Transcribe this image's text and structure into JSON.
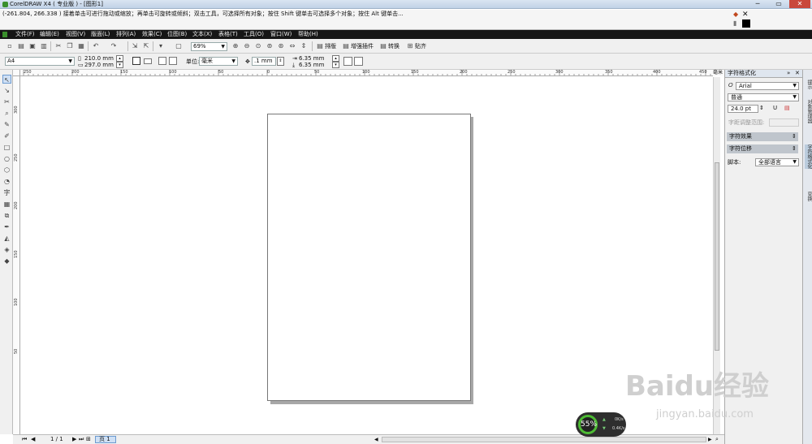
{
  "window": {
    "title": "CorelDRAW X4 ( 专业版 ) - [图形1]",
    "minimize_glyph": "─",
    "maximize_glyph": "▭",
    "close_glyph": "✕"
  },
  "hint_bar": {
    "text": "(-261.804, 266.338 )   接着单击可进行拖动或缩放；再单击可旋转或倾斜；双击工具，可选择所有对象；按住 Shift 键单击可选择多个对象；按住 Alt 键单击..."
  },
  "menu": {
    "items": [
      "文件(F)",
      "编辑(E)",
      "视图(V)",
      "版面(L)",
      "排列(A)",
      "效果(C)",
      "位图(B)",
      "文本(X)",
      "表格(T)",
      "工具(O)",
      "窗口(W)",
      "帮助(H)"
    ]
  },
  "toolbar": {
    "zoom_value": "69%",
    "arrange_label": "排版",
    "enhance_label": "增强插件",
    "convert_label": "转换",
    "snap_label": "贴齐"
  },
  "property_bar": {
    "paper_size": "A4",
    "width": "210.0 mm",
    "height": "297.0 mm",
    "units_label": "单位:",
    "units_value": "毫米",
    "nudge": ".1 mm",
    "dup_x": "6.35 mm",
    "dup_y": "6.35 mm"
  },
  "rulers": {
    "top_labels": [
      "250",
      "200",
      "150",
      "100",
      "50",
      "0",
      "50",
      "100",
      "150",
      "200",
      "250",
      "300",
      "350",
      "400",
      "450"
    ],
    "left_labels": [
      "300",
      "250",
      "200",
      "150",
      "100",
      "50"
    ],
    "unit_label": "毫米"
  },
  "status_bar": {
    "page_counter": "1 / 1",
    "page_tab": "页 1"
  },
  "docker": {
    "title": "字符格式化",
    "font_name": "Arial",
    "font_style": "普通",
    "font_size": "24.0 pt",
    "char_spacing_label": "字距调整范围:",
    "effects_section": "字符效果",
    "shift_section": "字符位移",
    "script_label": "脚本:",
    "script_value": "全部语言",
    "side_tabs": [
      "提示",
      "对象管理器",
      "字符格式化",
      "变换"
    ]
  },
  "performance_widget": {
    "percent": "55%",
    "up_rate": "0K/s",
    "down_rate": "0.4K/s"
  },
  "watermark": {
    "brand": "Baidu经验",
    "url": "jingyan.baidu.com"
  },
  "colors": {
    "menubar": "#161616",
    "page_border": "#777777",
    "page_shadow": "#a8a8a8",
    "accent_green": "#4dbb34"
  }
}
